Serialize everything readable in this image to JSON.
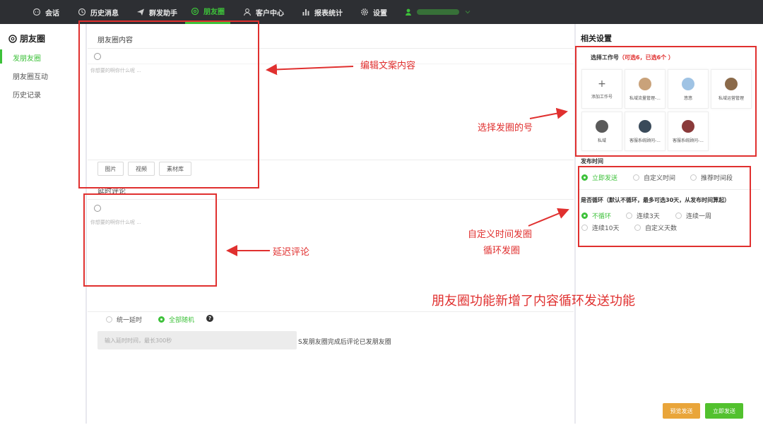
{
  "nav": {
    "items": [
      {
        "label": "会话",
        "icon": "chat-icon"
      },
      {
        "label": "历史消息",
        "icon": "clock-icon"
      },
      {
        "label": "群发助手",
        "icon": "send-icon"
      },
      {
        "label": "朋友圈",
        "icon": "moments-icon"
      },
      {
        "label": "客户中心",
        "icon": "user-icon"
      },
      {
        "label": "报表统计",
        "icon": "chart-icon"
      },
      {
        "label": "设置",
        "icon": "gear-icon"
      }
    ],
    "active": "朋友圈"
  },
  "sidebar": {
    "title": "朋友圈",
    "items": [
      {
        "label": "发朋友圈",
        "active": true
      },
      {
        "label": "朋友圈互动"
      },
      {
        "label": "历史记录"
      }
    ]
  },
  "editor": {
    "content_label": "朋友圈内容",
    "placeholder": "你想要的啊你什么呢 ...",
    "media_buttons": [
      "图片",
      "视频",
      "素材库"
    ],
    "comment_label": "延时评论",
    "comment_placeholder": "你想要的啊你什么呢 ...",
    "delay_options": [
      "统一延时",
      "全部随机"
    ],
    "delay_selected": "全部随机",
    "delay_input_placeholder": "输入延时时间，最长300秒",
    "delay_note": "S发朋友圈完成后评论已发朋友圈"
  },
  "settings": {
    "title": "相关设置",
    "choose_account_label": "选择工作号",
    "choose_account_hint": "（可选6，已选6个 ）",
    "accounts": [
      {
        "name": "添加工作号",
        "type": "add"
      },
      {
        "name": "私域流量管理-...",
        "color": "#c9a27a"
      },
      {
        "name": "悠悠",
        "color": "#9fc3e4"
      },
      {
        "name": "私域运营管理",
        "color": "#8b6a4a"
      },
      {
        "name": "私域",
        "color": "#5a5a5a"
      },
      {
        "name": "客服系统顾问-...",
        "color": "#3a4a5a"
      },
      {
        "name": "客服系统顾问-...",
        "color": "#8a3a3a"
      }
    ],
    "publish_time_label": "发布时间",
    "publish_options": [
      "立即发送",
      "自定义时间",
      "推荐时间段"
    ],
    "publish_selected": "立即发送",
    "loop_label": "是否循环（默认不循环，最多可选30天，从发布时间算起）",
    "loop_options": [
      "不循环",
      "连续3天",
      "连续一周",
      "连续10天",
      "自定义天数"
    ],
    "loop_selected": "不循环"
  },
  "buttons": {
    "preview": "预览发送",
    "send": "立即发送"
  },
  "annotations": {
    "edit": "编辑文案内容",
    "choose": "选择发圈的号",
    "delay": "延迟评论",
    "custom_time": "自定义时间发圈",
    "loop": "循环发圈",
    "headline": "朋友圈功能新增了内容循环发送功能"
  },
  "colors": {
    "accent": "#3dc13a",
    "annotation": "#e0302f",
    "preview_btn": "#e9a53a",
    "send_btn": "#52c12e",
    "topbar": "#2d2f33"
  }
}
